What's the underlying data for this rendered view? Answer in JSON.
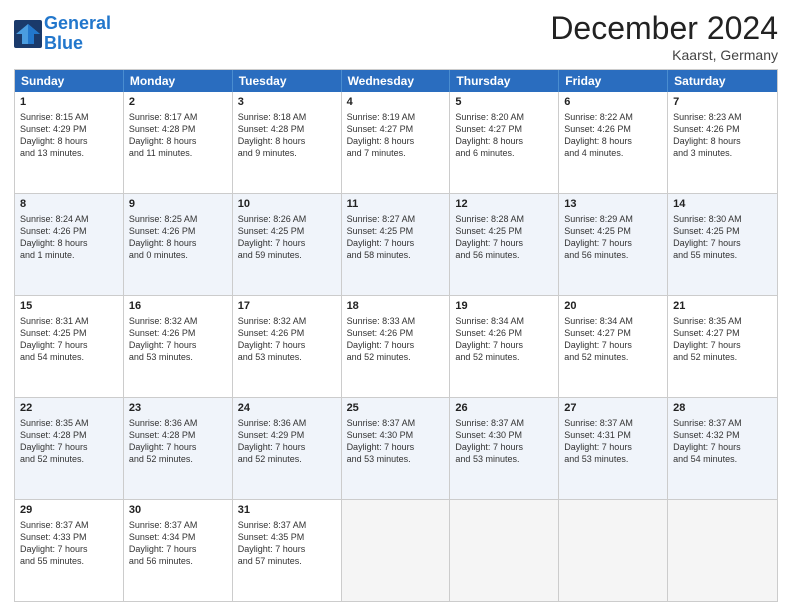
{
  "header": {
    "logo_line1": "General",
    "logo_line2": "Blue",
    "month_title": "December 2024",
    "location": "Kaarst, Germany"
  },
  "weekdays": [
    "Sunday",
    "Monday",
    "Tuesday",
    "Wednesday",
    "Thursday",
    "Friday",
    "Saturday"
  ],
  "weeks": [
    [
      {
        "day": "1",
        "info": "Sunrise: 8:15 AM\nSunset: 4:29 PM\nDaylight: 8 hours\nand 13 minutes."
      },
      {
        "day": "2",
        "info": "Sunrise: 8:17 AM\nSunset: 4:28 PM\nDaylight: 8 hours\nand 11 minutes."
      },
      {
        "day": "3",
        "info": "Sunrise: 8:18 AM\nSunset: 4:28 PM\nDaylight: 8 hours\nand 9 minutes."
      },
      {
        "day": "4",
        "info": "Sunrise: 8:19 AM\nSunset: 4:27 PM\nDaylight: 8 hours\nand 7 minutes."
      },
      {
        "day": "5",
        "info": "Sunrise: 8:20 AM\nSunset: 4:27 PM\nDaylight: 8 hours\nand 6 minutes."
      },
      {
        "day": "6",
        "info": "Sunrise: 8:22 AM\nSunset: 4:26 PM\nDaylight: 8 hours\nand 4 minutes."
      },
      {
        "day": "7",
        "info": "Sunrise: 8:23 AM\nSunset: 4:26 PM\nDaylight: 8 hours\nand 3 minutes."
      }
    ],
    [
      {
        "day": "8",
        "info": "Sunrise: 8:24 AM\nSunset: 4:26 PM\nDaylight: 8 hours\nand 1 minute."
      },
      {
        "day": "9",
        "info": "Sunrise: 8:25 AM\nSunset: 4:26 PM\nDaylight: 8 hours\nand 0 minutes."
      },
      {
        "day": "10",
        "info": "Sunrise: 8:26 AM\nSunset: 4:25 PM\nDaylight: 7 hours\nand 59 minutes."
      },
      {
        "day": "11",
        "info": "Sunrise: 8:27 AM\nSunset: 4:25 PM\nDaylight: 7 hours\nand 58 minutes."
      },
      {
        "day": "12",
        "info": "Sunrise: 8:28 AM\nSunset: 4:25 PM\nDaylight: 7 hours\nand 56 minutes."
      },
      {
        "day": "13",
        "info": "Sunrise: 8:29 AM\nSunset: 4:25 PM\nDaylight: 7 hours\nand 56 minutes."
      },
      {
        "day": "14",
        "info": "Sunrise: 8:30 AM\nSunset: 4:25 PM\nDaylight: 7 hours\nand 55 minutes."
      }
    ],
    [
      {
        "day": "15",
        "info": "Sunrise: 8:31 AM\nSunset: 4:25 PM\nDaylight: 7 hours\nand 54 minutes."
      },
      {
        "day": "16",
        "info": "Sunrise: 8:32 AM\nSunset: 4:26 PM\nDaylight: 7 hours\nand 53 minutes."
      },
      {
        "day": "17",
        "info": "Sunrise: 8:32 AM\nSunset: 4:26 PM\nDaylight: 7 hours\nand 53 minutes."
      },
      {
        "day": "18",
        "info": "Sunrise: 8:33 AM\nSunset: 4:26 PM\nDaylight: 7 hours\nand 52 minutes."
      },
      {
        "day": "19",
        "info": "Sunrise: 8:34 AM\nSunset: 4:26 PM\nDaylight: 7 hours\nand 52 minutes."
      },
      {
        "day": "20",
        "info": "Sunrise: 8:34 AM\nSunset: 4:27 PM\nDaylight: 7 hours\nand 52 minutes."
      },
      {
        "day": "21",
        "info": "Sunrise: 8:35 AM\nSunset: 4:27 PM\nDaylight: 7 hours\nand 52 minutes."
      }
    ],
    [
      {
        "day": "22",
        "info": "Sunrise: 8:35 AM\nSunset: 4:28 PM\nDaylight: 7 hours\nand 52 minutes."
      },
      {
        "day": "23",
        "info": "Sunrise: 8:36 AM\nSunset: 4:28 PM\nDaylight: 7 hours\nand 52 minutes."
      },
      {
        "day": "24",
        "info": "Sunrise: 8:36 AM\nSunset: 4:29 PM\nDaylight: 7 hours\nand 52 minutes."
      },
      {
        "day": "25",
        "info": "Sunrise: 8:37 AM\nSunset: 4:30 PM\nDaylight: 7 hours\nand 53 minutes."
      },
      {
        "day": "26",
        "info": "Sunrise: 8:37 AM\nSunset: 4:30 PM\nDaylight: 7 hours\nand 53 minutes."
      },
      {
        "day": "27",
        "info": "Sunrise: 8:37 AM\nSunset: 4:31 PM\nDaylight: 7 hours\nand 53 minutes."
      },
      {
        "day": "28",
        "info": "Sunrise: 8:37 AM\nSunset: 4:32 PM\nDaylight: 7 hours\nand 54 minutes."
      }
    ],
    [
      {
        "day": "29",
        "info": "Sunrise: 8:37 AM\nSunset: 4:33 PM\nDaylight: 7 hours\nand 55 minutes."
      },
      {
        "day": "30",
        "info": "Sunrise: 8:37 AM\nSunset: 4:34 PM\nDaylight: 7 hours\nand 56 minutes."
      },
      {
        "day": "31",
        "info": "Sunrise: 8:37 AM\nSunset: 4:35 PM\nDaylight: 7 hours\nand 57 minutes."
      },
      {
        "day": "",
        "info": ""
      },
      {
        "day": "",
        "info": ""
      },
      {
        "day": "",
        "info": ""
      },
      {
        "day": "",
        "info": ""
      }
    ]
  ]
}
